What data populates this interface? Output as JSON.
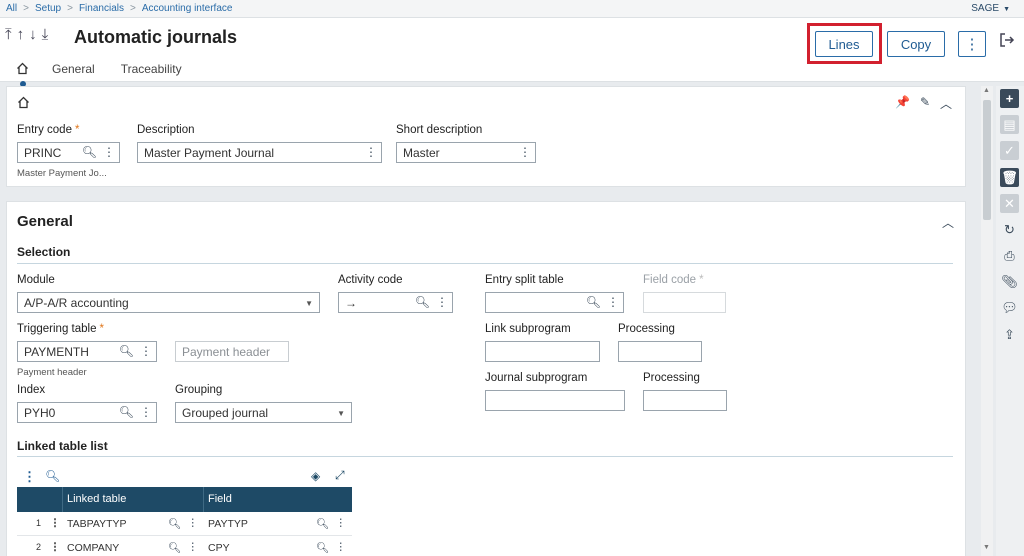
{
  "breadcrumb": {
    "items": [
      "All",
      "Setup",
      "Financials",
      "Accounting interface"
    ],
    "user": "SAGE"
  },
  "header": {
    "title": "Automatic journals",
    "buttons": {
      "lines": "Lines",
      "copy": "Copy"
    },
    "tabs": [
      "General",
      "Traceability"
    ]
  },
  "card1": {
    "entry_code": {
      "label": "Entry code",
      "value": "PRINC",
      "sub": "Master Payment Jo..."
    },
    "description": {
      "label": "Description",
      "value": "Master Payment Journal"
    },
    "short_description": {
      "label": "Short description",
      "value": "Master"
    }
  },
  "general": {
    "title": "General",
    "selection_title": "Selection",
    "module": {
      "label": "Module",
      "value": "A/P-A/R accounting"
    },
    "activity_code": {
      "label": "Activity code",
      "value": "→"
    },
    "entry_split_table": {
      "label": "Entry split table",
      "value": ""
    },
    "field_code": {
      "label": "Field code",
      "value": ""
    },
    "triggering_table": {
      "label": "Triggering table",
      "value": "PAYMENTH",
      "sub": "Payment header",
      "desc_placeholder": "Payment header"
    },
    "link_subprogram": {
      "label": "Link subprogram",
      "value": ""
    },
    "processing1": {
      "label": "Processing",
      "value": ""
    },
    "index": {
      "label": "Index",
      "value": "PYH0"
    },
    "grouping": {
      "label": "Grouping",
      "value": "Grouped journal"
    },
    "journal_subprogram": {
      "label": "Journal subprogram",
      "value": ""
    },
    "processing2": {
      "label": "Processing",
      "value": ""
    },
    "linked_table_list": {
      "title": "Linked table list",
      "columns": [
        "Linked table",
        "Field"
      ],
      "rows": [
        {
          "num": "1",
          "table": "TABPAYTYP",
          "field": "PAYTYP"
        },
        {
          "num": "2",
          "table": "COMPANY",
          "field": "CPY"
        }
      ]
    }
  },
  "colors": {
    "accent": "#1f5b92",
    "highlight": "#d2202f",
    "grid_header": "#1e4a66",
    "required": "#e0761a"
  },
  "icons": [
    "home-icon",
    "search-icon",
    "more-vert-icon",
    "pin-icon",
    "edit-icon",
    "chevron-up-icon",
    "layers-icon",
    "expand-icon",
    "plus-icon",
    "save-icon",
    "check-icon",
    "trash-icon",
    "close-icon",
    "refresh-icon",
    "print-icon",
    "attach-icon",
    "comment-icon",
    "export-icon",
    "exit-icon"
  ]
}
